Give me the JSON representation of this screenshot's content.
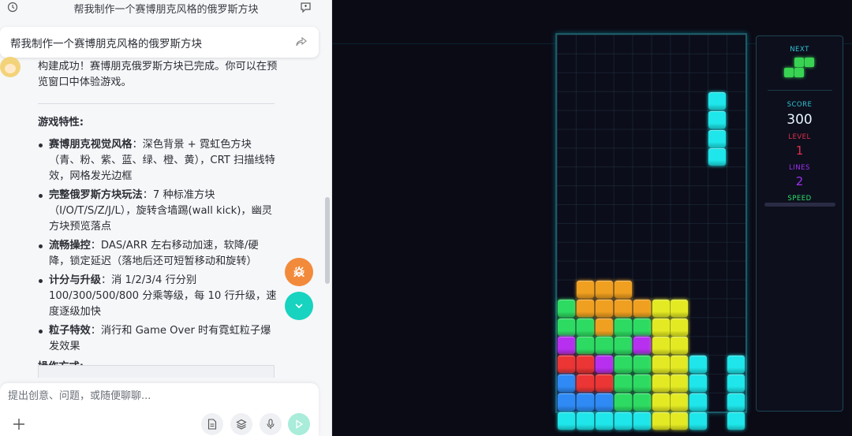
{
  "chat": {
    "title": "帮我制作一个赛博朋克风格的俄罗斯方块",
    "prompt": "帮我制作一个赛博朋克风格的俄罗斯方块",
    "intro": "构建成功！赛博朋克俄罗斯方块已完成。你可以在预览窗口中体验游戏。",
    "features_heading": "游戏特性:",
    "features": [
      {
        "title": "赛博朋克视觉风格",
        "text": "：深色背景 + 霓虹色方块（青、粉、紫、蓝、绿、橙、黄），CRT 扫描线特效，网格发光边框"
      },
      {
        "title": "完整俄罗斯方块玩法",
        "text": "：7 种标准方块（I/O/T/S/Z/J/L），旋转含墙踢(wall kick)，幽灵方块预览落点"
      },
      {
        "title": "流畅操控",
        "text": "：DAS/ARR 左右移动加速，软降/硬降，锁定延迟（落地后还可短暂移动和旋转）"
      },
      {
        "title": "计分与升级",
        "text": "：消 1/2/3/4 行分别 100/300/500/800 分乘等级，每 10 行升级，速度逐级加快"
      },
      {
        "title": "粒子特效",
        "text": "：消行和 Game Over 时有霓虹粒子爆发效果"
      }
    ],
    "ops_heading": "操作方式:",
    "fab_label": "焱",
    "composer_placeholder": "提出创意、问题，或随便聊聊..."
  },
  "game": {
    "next_label": "NEXT",
    "score_label": "SCORE",
    "score": "300",
    "level_label": "LEVEL",
    "level": "1",
    "lines_label": "LINES",
    "lines": "2",
    "speed_label": "SPEED",
    "speed_level": 0,
    "colors": {
      "C": "#1ee6ea",
      "Y": "#e3ea23",
      "G": "#2edb62",
      "O": "#f0a020",
      "P": "#b730f0",
      "R": "#ec3535",
      "B": "#2f8af5",
      "accent_cyan": "#2ec4d4",
      "accent_red": "#e0304a",
      "accent_purple": "#a030f0",
      "accent_green": "#2ee06a"
    },
    "board_rows": [
      "..........",
      "..........",
      "..........",
      "........C.",
      "........C.",
      "........C.",
      "........C.",
      "..........",
      "..........",
      "..........",
      "..........",
      "..........",
      "..........",
      ".OOO......",
      "GOOOOYY...",
      "GGOGGYY...",
      "PGGGPYY...",
      "RRPGGYYC.C",
      "BRRGGYYC.C",
      "BBBGGYYC.C",
      "CCCCCYYC.C"
    ],
    "next_shape": [
      "..GG",
      ".GG."
    ]
  }
}
